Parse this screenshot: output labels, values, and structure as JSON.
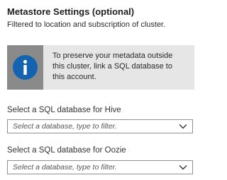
{
  "section": {
    "title": "Metastore Settings (optional)",
    "subtitle": "Filtered to location and subscription of cluster."
  },
  "info": {
    "icon": "info-icon",
    "message": "To preserve your metadata outside\nthis cluster, link a SQL database to\nthis account.",
    "colors": {
      "icon_bar": "#8a8a8a",
      "icon_circle": "#1463b0",
      "box_background": "#e6e6e6"
    }
  },
  "fields": {
    "hive": {
      "label": "Select a SQL database for Hive",
      "placeholder": "Select a database, type to filter.",
      "icon": "chevron-down-icon"
    },
    "oozie": {
      "label": "Select a SQL database for Oozie",
      "placeholder": "Select a database, type to filter.",
      "icon": "chevron-down-icon"
    }
  }
}
